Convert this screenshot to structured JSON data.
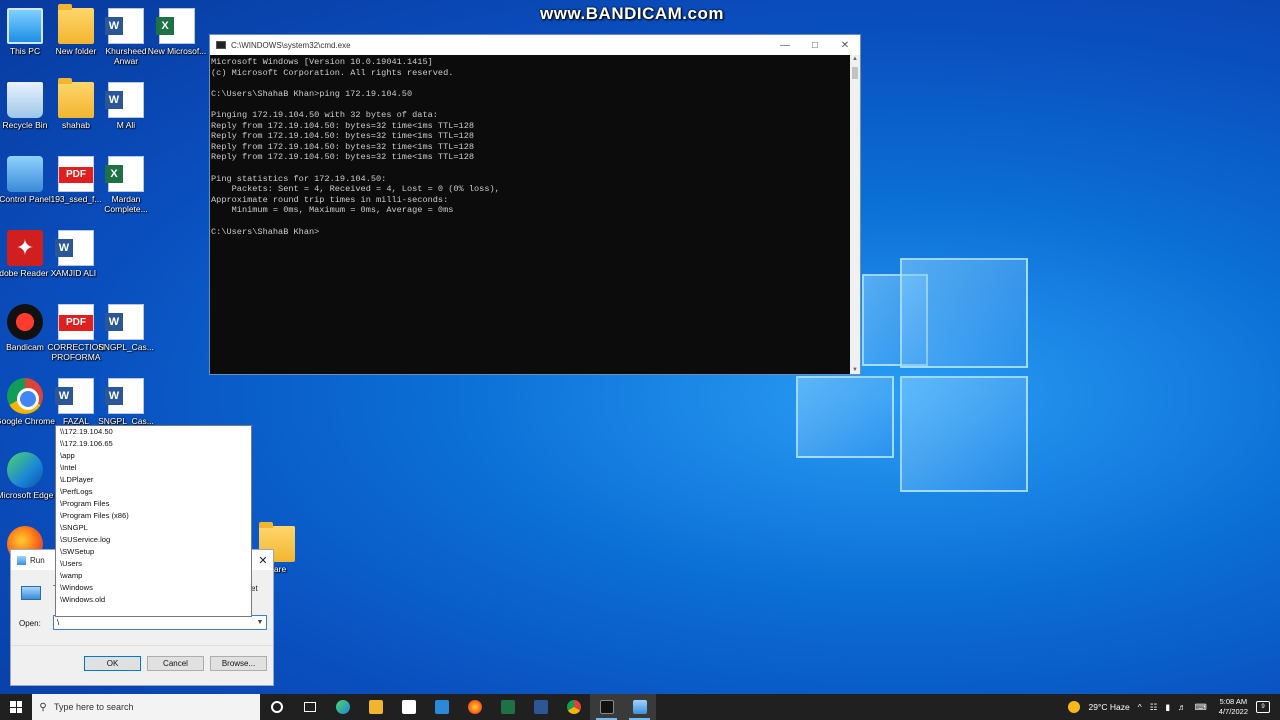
{
  "watermark": "www.BANDICAM.com",
  "desktop_icons": [
    {
      "label": "This PC"
    },
    {
      "label": "New folder"
    },
    {
      "label": "Khursheed Anwar"
    },
    {
      "label": "New Microsof..."
    },
    {
      "label": "Recycle Bin"
    },
    {
      "label": "shahab"
    },
    {
      "label": "M Ali"
    },
    {
      "label": "Control Panel"
    },
    {
      "label": "193_ssed_f..."
    },
    {
      "label": "Mardan Complete..."
    },
    {
      "label": "Adobe Reader X"
    },
    {
      "label": "AMJID ALI"
    },
    {
      "label": "Bandicam"
    },
    {
      "label": "CORRECTION PROFORMA"
    },
    {
      "label": "SNGPL_Cas..."
    },
    {
      "label": "Google Chrome"
    },
    {
      "label": "FAZAL"
    },
    {
      "label": "SNGPL_Cas..."
    },
    {
      "label": "Microsoft Edge"
    },
    {
      "label": "ware"
    }
  ],
  "cmd": {
    "title": "C:\\WINDOWS\\system32\\cmd.exe",
    "lines": [
      "Microsoft Windows [Version 10.0.19041.1415]",
      "(c) Microsoft Corporation. All rights reserved.",
      "",
      "C:\\Users\\ShahaB Khan>ping 172.19.104.50",
      "",
      "Pinging 172.19.104.50 with 32 bytes of data:",
      "Reply from 172.19.104.50: bytes=32 time<1ms TTL=128",
      "Reply from 172.19.104.50: bytes=32 time<1ms TTL=128",
      "Reply from 172.19.104.50: bytes=32 time<1ms TTL=128",
      "Reply from 172.19.104.50: bytes=32 time<1ms TTL=128",
      "",
      "Ping statistics for 172.19.104.50:",
      "    Packets: Sent = 4, Received = 4, Lost = 0 (0% loss),",
      "Approximate round trip times in milli-seconds:",
      "    Minimum = 0ms, Maximum = 0ms, Average = 0ms",
      "",
      "C:\\Users\\ShahaB Khan>"
    ]
  },
  "run": {
    "title": "Run",
    "partial_text_left": "T",
    "partial_text_right": "et",
    "open_label": "Open:",
    "open_value": "\\",
    "ok_label": "OK",
    "cancel_label": "Cancel",
    "browse_label": "Browse..."
  },
  "autocomplete": [
    "\\\\172.19.104.50",
    "\\\\172.19.106.65",
    "\\app",
    "\\Intel",
    "\\LDPlayer",
    "\\PerfLogs",
    "\\Program Files",
    "\\Program Files (x86)",
    "\\SNGPL",
    "\\SUService.log",
    "\\SWSetup",
    "\\Users",
    "\\wamp",
    "\\Windows",
    "\\Windows.old"
  ],
  "taskbar": {
    "search_placeholder": "Type here to search",
    "weather": "29°C  Haze",
    "time": "5:08 AM",
    "date": "4/7/2022",
    "notification_count": "9"
  },
  "colors": {
    "console_bg": "#0c0c0c",
    "console_text": "#cccccc",
    "taskbar_bg": "#202020",
    "accent": "#0078d7"
  }
}
